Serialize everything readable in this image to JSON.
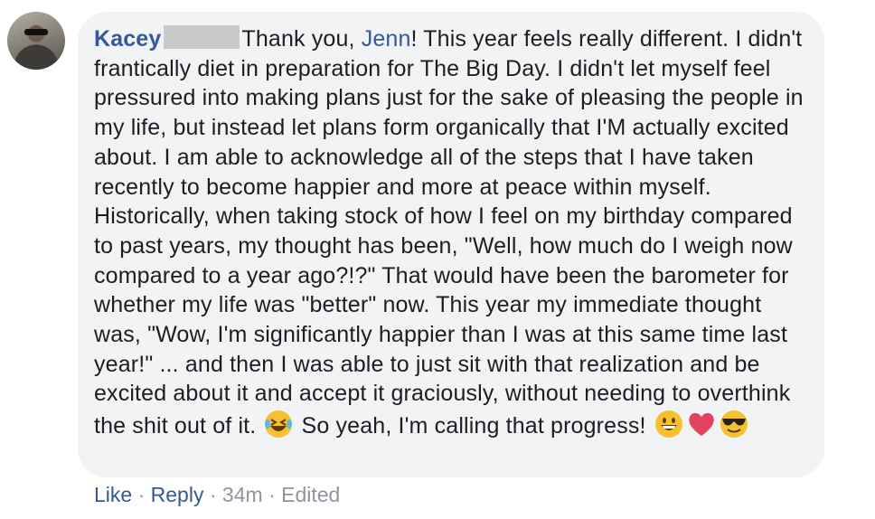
{
  "comment": {
    "author_first": "Kacey",
    "segments": {
      "t0": "Thank you, ",
      "mention": "Jenn",
      "t1": "! This year feels really different. I didn't frantically diet in preparation for The Big Day. I didn't let myself feel pressured into making plans just for the sake of pleasing the people in my life, but instead let plans form organically that I'M actually excited about. I am able to acknowledge all of the steps that I have taken recently to become happier and more at peace within myself. Historically, when taking stock of how I feel on my birthday compared to past years, my thought has been, \"Well, how much do I weigh now compared to a year ago?!?\" That would have been the barometer for whether my life was \"better\" now. This year my immediate thought was, \"Wow, I'm significantly happier than I was at this same time last year!\" ... and then I was able to just sit with that realization and be excited about it and accept it graciously, without needing to overthink the shit out of it.",
      "t2": " So yeah, I'm calling that progress! "
    },
    "emojis": [
      "laughing-tears-emoji",
      "grinning-emoji",
      "heart-emoji",
      "sunglasses-emoji"
    ]
  },
  "actions": {
    "like": "Like",
    "reply": "Reply",
    "dot": "·",
    "time": "34m",
    "edited": "Edited"
  },
  "colors": {
    "link": "#365899",
    "text": "#1c1e21",
    "meta": "#90949c",
    "bubble": "#f2f3f5"
  }
}
